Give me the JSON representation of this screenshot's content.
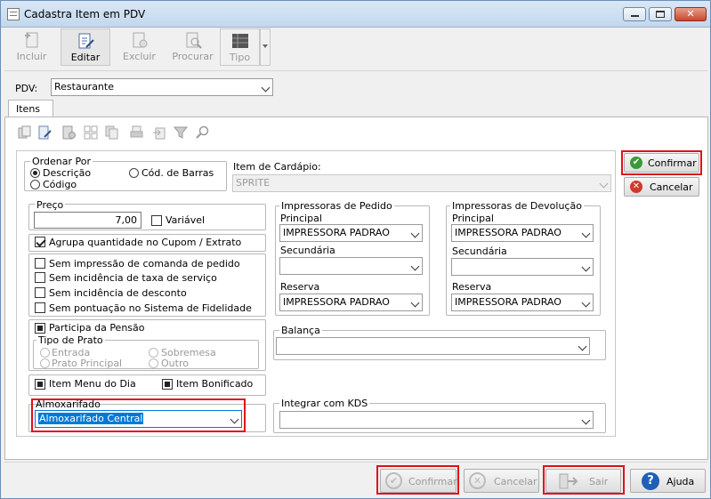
{
  "window": {
    "title": "Cadastra Item em PDV"
  },
  "toolbar": {
    "incluir": "Incluir",
    "editar": "Editar",
    "excluir": "Excluir",
    "procurar": "Procurar",
    "tipo": "Tipo"
  },
  "pdv": {
    "label": "PDV:",
    "value": "Restaurante"
  },
  "tab": {
    "label": "Itens"
  },
  "ordenar": {
    "caption": "Ordenar Por",
    "descricao": "Descrição",
    "codigo": "Código",
    "cod_barras": "Cód. de Barras"
  },
  "item_cardapio": {
    "label": "Item de Cardápio:",
    "value": "SPRITE"
  },
  "preco": {
    "caption": "Preço",
    "value": "7,00",
    "variavel": "Variável"
  },
  "checks": {
    "agrupa": "Agrupa quantidade no Cupom / Extrato",
    "sem_impressao": "Sem impressão de comanda de pedido",
    "sem_taxa": "Sem incidência de taxa de serviço",
    "sem_desconto": "Sem incidência de desconto",
    "sem_pontuacao": "Sem pontuação no Sistema de Fidelidade",
    "participa": "Participa da Pensão",
    "menu_dia": "Item Menu do Dia",
    "bonificado": "Item Bonificado"
  },
  "tipo_prato": {
    "caption": "Tipo de Prato",
    "entrada": "Entrada",
    "sobremesa": "Sobremesa",
    "principal": "Prato Principal",
    "outro": "Outro"
  },
  "almox": {
    "caption": "Almoxarifado",
    "value": "Almoxarifado Central"
  },
  "imp_pedido": {
    "caption": "Impressoras de Pedido",
    "principal": "Principal",
    "principal_val": "IMPRESSORA PADRAO",
    "secundaria": "Secundária",
    "secundaria_val": "",
    "reserva": "Reserva",
    "reserva_val": "IMPRESSORA PADRAO"
  },
  "imp_devol": {
    "caption": "Impressoras de Devolução",
    "principal": "Principal",
    "principal_val": "IMPRESSORA PADRAO",
    "secundaria": "Secundária",
    "secundaria_val": "",
    "reserva": "Reserva",
    "reserva_val": "IMPRESSORA PADRAO"
  },
  "balanca": {
    "caption": "Balança",
    "value": ""
  },
  "kds": {
    "caption": "Integrar com KDS",
    "value": ""
  },
  "side": {
    "confirmar": "Confirmar",
    "cancelar": "Cancelar"
  },
  "bottom": {
    "confirmar": "Confirmar",
    "cancelar": "Cancelar",
    "sair": "Sair",
    "ajuda": "Ajuda"
  },
  "colors": {
    "highlight": "#e0101a",
    "selection": "#0078d7",
    "confirm_green": "#3a9a3a",
    "cancel_red": "#d03a2a",
    "help_blue": "#1f5fb8"
  }
}
